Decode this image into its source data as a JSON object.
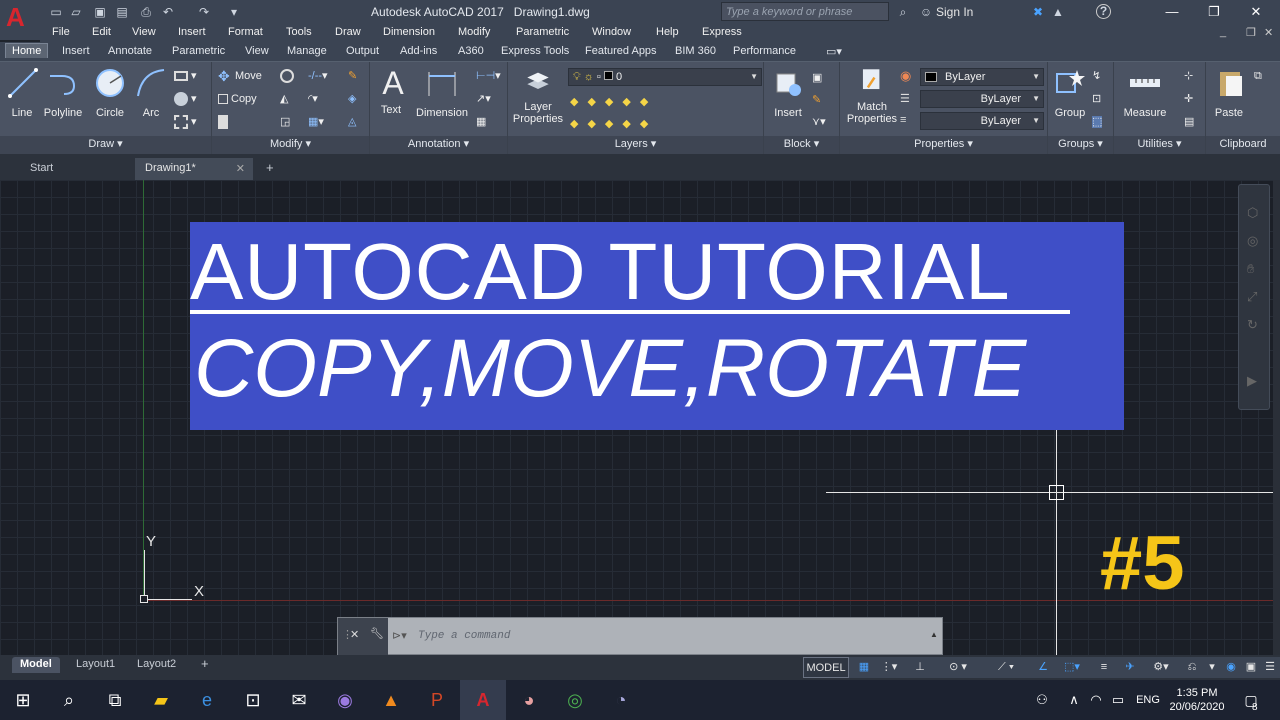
{
  "app": {
    "logo": "A",
    "title": "Autodesk AutoCAD 2017",
    "file_name": "Drawing1.dwg",
    "search_placeholder": "Type a keyword or phrase",
    "sign_in": "Sign In",
    "help": "?"
  },
  "menu": [
    "File",
    "Edit",
    "View",
    "Insert",
    "Format",
    "Tools",
    "Draw",
    "Dimension",
    "Modify",
    "Parametric",
    "Window",
    "Help",
    "Express"
  ],
  "ribbon_tabs": [
    "Home",
    "Insert",
    "Annotate",
    "Parametric",
    "View",
    "Manage",
    "Output",
    "Add-ins",
    "A360",
    "Express Tools",
    "Featured Apps",
    "BIM 360",
    "Performance"
  ],
  "draw": {
    "title": "Draw",
    "line": "Line",
    "polyline": "Polyline",
    "circle": "Circle",
    "arc": "Arc"
  },
  "modify": {
    "title": "Modify",
    "move": "Move",
    "copy": "Copy"
  },
  "annotation": {
    "title": "Annotation",
    "text": "Text",
    "dimension": "Dimension"
  },
  "layers": {
    "title": "Layers",
    "layer_properties_1": "Layer",
    "layer_properties_2": "Properties",
    "current_layer": "0"
  },
  "block": {
    "title": "Block",
    "insert": "Insert"
  },
  "properties": {
    "title": "Properties",
    "match_1": "Match",
    "match_2": "Properties",
    "color": "ByLayer",
    "linetype": "ByLayer",
    "lineweight": "ByLayer"
  },
  "groups": {
    "title": "Groups",
    "group": "Group"
  },
  "utilities": {
    "title": "Utilities",
    "measure": "Measure"
  },
  "clipboard": {
    "title": "Clipboard",
    "paste": "Paste"
  },
  "file_tabs": {
    "start": "Start",
    "drawing": "Drawing1*",
    "close": "✕",
    "add": "+"
  },
  "overlay": {
    "line1": "AUTOCAD TUTORIAL",
    "line2": "COPY,MOVE,ROTATE",
    "episode": "#5"
  },
  "ucs": {
    "x": "X",
    "y": "Y"
  },
  "command": {
    "placeholder": "Type a command"
  },
  "layout_tabs": [
    "Model",
    "Layout1",
    "Layout2"
  ],
  "status": {
    "model": "MODEL"
  },
  "taskbar": {
    "lang": "ENG",
    "time": "1:35 PM",
    "date": "20/06/2020",
    "notifications": "8"
  },
  "colors": {
    "banner": "#3f4fc7",
    "episode": "#f5c518",
    "canvas": "#1b1f27",
    "logo_red": "#d8262e"
  }
}
